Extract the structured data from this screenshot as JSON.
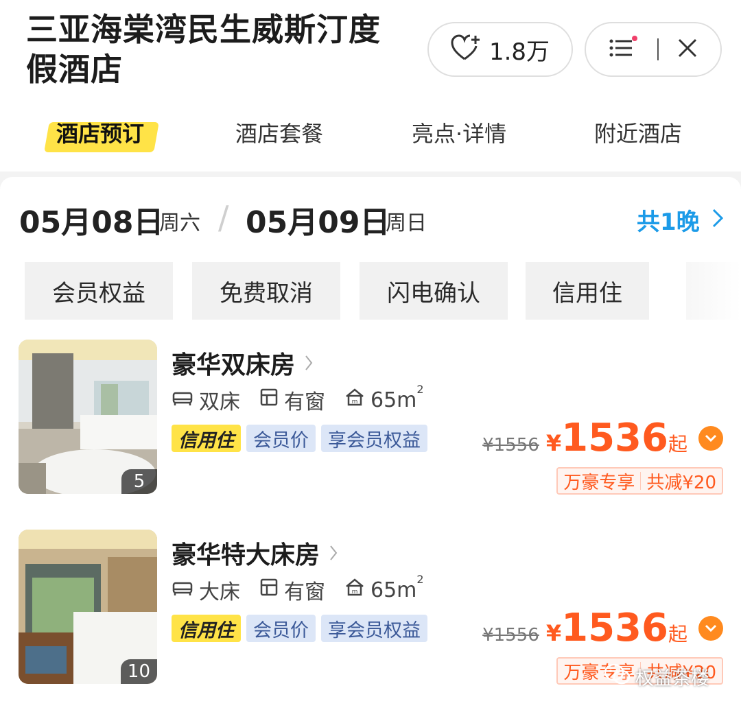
{
  "header": {
    "title": "三亚海棠湾民生威斯汀度假酒店",
    "favorite_count": "1.8万"
  },
  "tabs": [
    {
      "label": "酒店预订",
      "active": true
    },
    {
      "label": "酒店套餐",
      "active": false
    },
    {
      "label": "亮点·详情",
      "active": false
    },
    {
      "label": "附近酒店",
      "active": false
    }
  ],
  "dates": {
    "checkin": "05月08日",
    "checkin_day": "周六",
    "checkout": "05月09日",
    "checkout_day": "周日",
    "nights": "共1晚"
  },
  "filters": [
    "会员权益",
    "免费取消",
    "闪电确认",
    "信用住"
  ],
  "rooms": [
    {
      "name": "豪华双床房",
      "bed": "双床",
      "window": "有窗",
      "area": "65m",
      "area_sup": "2",
      "photo_count": "5",
      "tags": [
        "信用住",
        "会员价",
        "享会员权益"
      ],
      "original_price": "¥1556",
      "currency": "¥",
      "price": "1536",
      "price_suffix": "起",
      "promo_left": "万豪专享",
      "promo_right": "共减¥20"
    },
    {
      "name": "豪华特大床房",
      "bed": "大床",
      "window": "有窗",
      "area": "65m",
      "area_sup": "2",
      "photo_count": "10",
      "tags": [
        "信用住",
        "会员价",
        "享会员权益"
      ],
      "original_price": "¥1556",
      "currency": "¥",
      "price": "1536",
      "price_suffix": "起",
      "promo_left": "万豪专享",
      "promo_right": "共减¥20"
    }
  ],
  "watermark": "权益茶楼",
  "colors": {
    "accent_yellow": "#ffe347",
    "price_orange": "#ff5a1f",
    "link_blue": "#1c9be8",
    "member_tag_bg": "#dce6f7"
  }
}
